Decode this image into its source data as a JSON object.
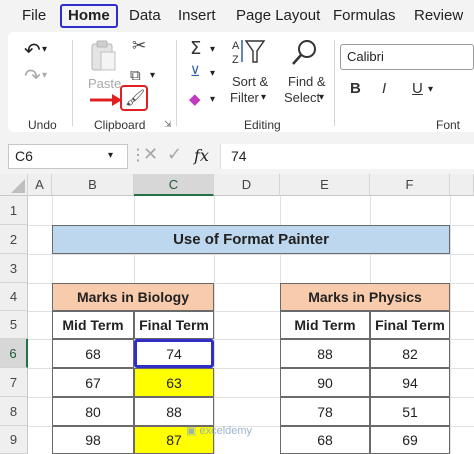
{
  "menubar": {
    "tabs": [
      "File",
      "Home",
      "Data",
      "Insert",
      "Page Layout",
      "Formulas",
      "Review"
    ]
  },
  "ribbon": {
    "groups": {
      "undo": "Undo",
      "clipboard": "Clipboard",
      "editing": "Editing",
      "font": "Font"
    },
    "paste_label": "Paste",
    "sort_filter_label": [
      "Sort &",
      "Filter"
    ],
    "find_select_label": [
      "Find &",
      "Select"
    ],
    "font_name": "Calibri",
    "font_buttons": [
      "B",
      "I",
      "U"
    ],
    "icons": [
      "undo-icon",
      "redo-icon",
      "paste-icon",
      "cut-icon",
      "copy-icon",
      "format-painter-icon",
      "autosum-icon",
      "fill-icon",
      "clear-icon",
      "sort-filter-icon",
      "find-select-icon"
    ],
    "accent_color": "#e02020"
  },
  "formula_bar": {
    "name_box": "C6",
    "fx": "fx",
    "value": "74"
  },
  "grid": {
    "columns": [
      "A",
      "B",
      "C",
      "D",
      "E",
      "F"
    ],
    "rows": [
      "1",
      "2",
      "3",
      "4",
      "5",
      "6",
      "7",
      "8",
      "9"
    ],
    "selected_column": "C",
    "selected_row": "6"
  },
  "sheet": {
    "title": "Use of Format Painter",
    "biology": {
      "header": "Marks in Biology",
      "columns": [
        "Mid Term",
        "Final Term"
      ],
      "rows": [
        [
          "68",
          "74"
        ],
        [
          "67",
          "63"
        ],
        [
          "80",
          "88"
        ],
        [
          "98",
          "87"
        ]
      ]
    },
    "physics": {
      "header": "Marks in Physics",
      "columns": [
        "Mid Term",
        "Final Term"
      ],
      "rows": [
        [
          "88",
          "82"
        ],
        [
          "90",
          "94"
        ],
        [
          "78",
          "51"
        ],
        [
          "68",
          "69"
        ]
      ]
    },
    "highlight_color": "#ffff00",
    "title_color": "#bdd7ee",
    "header_color": "#f8cbad"
  },
  "watermark": "exceldemy"
}
